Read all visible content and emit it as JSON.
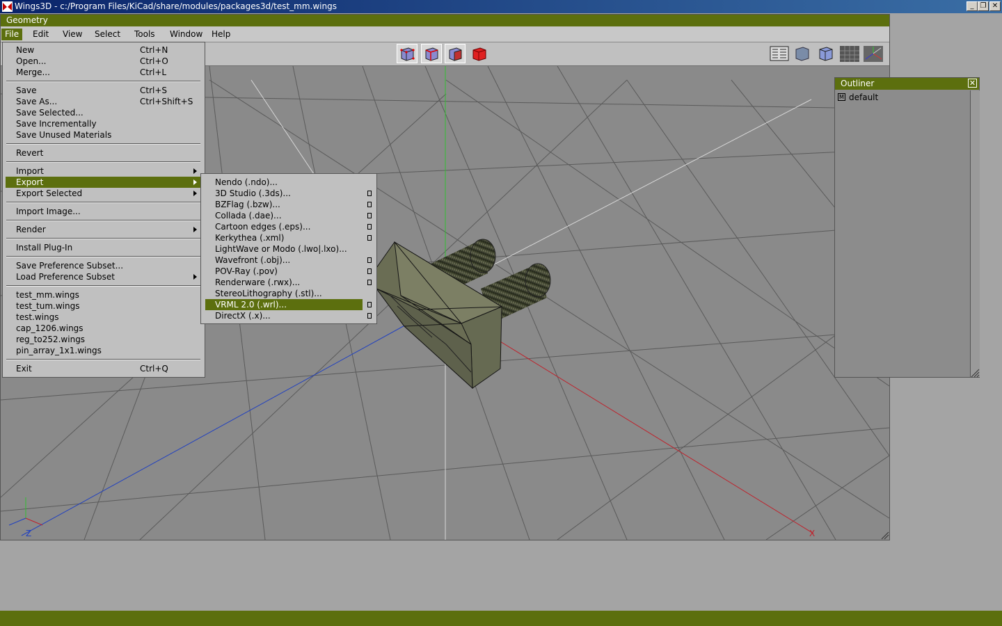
{
  "window": {
    "title": "Wings3D - c:/Program Files/KiCad/share/modules/packages3d/test_mm.wings",
    "controls": [
      "_",
      "❐",
      "✕"
    ]
  },
  "geometry": {
    "title": "Geometry"
  },
  "menubar": [
    "File",
    "Edit",
    "View",
    "Select",
    "Tools",
    "Window",
    "Help"
  ],
  "file_menu": {
    "groups": [
      [
        {
          "label": "New",
          "shortcut": "Ctrl+N"
        },
        {
          "label": "Open...",
          "shortcut": "Ctrl+O"
        },
        {
          "label": "Merge...",
          "shortcut": "Ctrl+L"
        }
      ],
      [
        {
          "label": "Save",
          "shortcut": "Ctrl+S"
        },
        {
          "label": "Save As...",
          "shortcut": "Ctrl+Shift+S"
        },
        {
          "label": "Save Selected...",
          "shortcut": ""
        },
        {
          "label": "Save Incrementally",
          "shortcut": ""
        },
        {
          "label": "Save Unused Materials",
          "shortcut": ""
        }
      ],
      [
        {
          "label": "Revert",
          "shortcut": ""
        }
      ],
      [
        {
          "label": "Import",
          "shortcut": "",
          "submenu": true
        },
        {
          "label": "Export",
          "shortcut": "",
          "submenu": true,
          "highlight": true
        },
        {
          "label": "Export Selected",
          "shortcut": "",
          "submenu": true
        }
      ],
      [
        {
          "label": "Import Image...",
          "shortcut": ""
        }
      ],
      [
        {
          "label": "Render",
          "shortcut": "",
          "submenu": true
        }
      ],
      [
        {
          "label": "Install Plug-In",
          "shortcut": ""
        }
      ],
      [
        {
          "label": "Save Preference Subset...",
          "shortcut": ""
        },
        {
          "label": "Load Preference Subset",
          "shortcut": "",
          "submenu": true
        }
      ],
      [
        {
          "label": "test_mm.wings",
          "shortcut": ""
        },
        {
          "label": "test_tum.wings",
          "shortcut": ""
        },
        {
          "label": "test.wings",
          "shortcut": ""
        },
        {
          "label": "cap_1206.wings",
          "shortcut": ""
        },
        {
          "label": "reg_to252.wings",
          "shortcut": ""
        },
        {
          "label": "pin_array_1x1.wings",
          "shortcut": ""
        }
      ],
      [
        {
          "label": "Exit",
          "shortcut": "Ctrl+Q"
        }
      ]
    ]
  },
  "export_menu": [
    {
      "label": "Nendo (.ndo)...",
      "option": false
    },
    {
      "label": "3D Studio (.3ds)...",
      "option": true
    },
    {
      "label": "BZFlag (.bzw)...",
      "option": true
    },
    {
      "label": "Collada (.dae)...",
      "option": true
    },
    {
      "label": "Cartoon edges (.eps)...",
      "option": true
    },
    {
      "label": "Kerkythea (.xml)",
      "option": true
    },
    {
      "label": "LightWave or Modo (.lwo|.lxo)...",
      "option": false
    },
    {
      "label": "Wavefront (.obj)...",
      "option": true
    },
    {
      "label": "POV-Ray (.pov)",
      "option": true
    },
    {
      "label": "Renderware (.rwx)...",
      "option": true
    },
    {
      "label": "StereoLithography (.stl)...",
      "option": false
    },
    {
      "label": "VRML 2.0 (.wrl)...",
      "option": true,
      "highlight": true
    },
    {
      "label": "DirectX (.x)...",
      "option": true
    }
  ],
  "outliner": {
    "title": "Outliner",
    "item_badge": "M",
    "item_label": "default"
  },
  "axes": {
    "x": "X",
    "z": "Z"
  },
  "colors": {
    "accent": "#5c6f0e",
    "menu_bg": "#c0c0c0",
    "viewport": "#8a8a8a",
    "axis_x": "#c0202a",
    "axis_y": "#30c030",
    "axis_z": "#2040c0"
  }
}
